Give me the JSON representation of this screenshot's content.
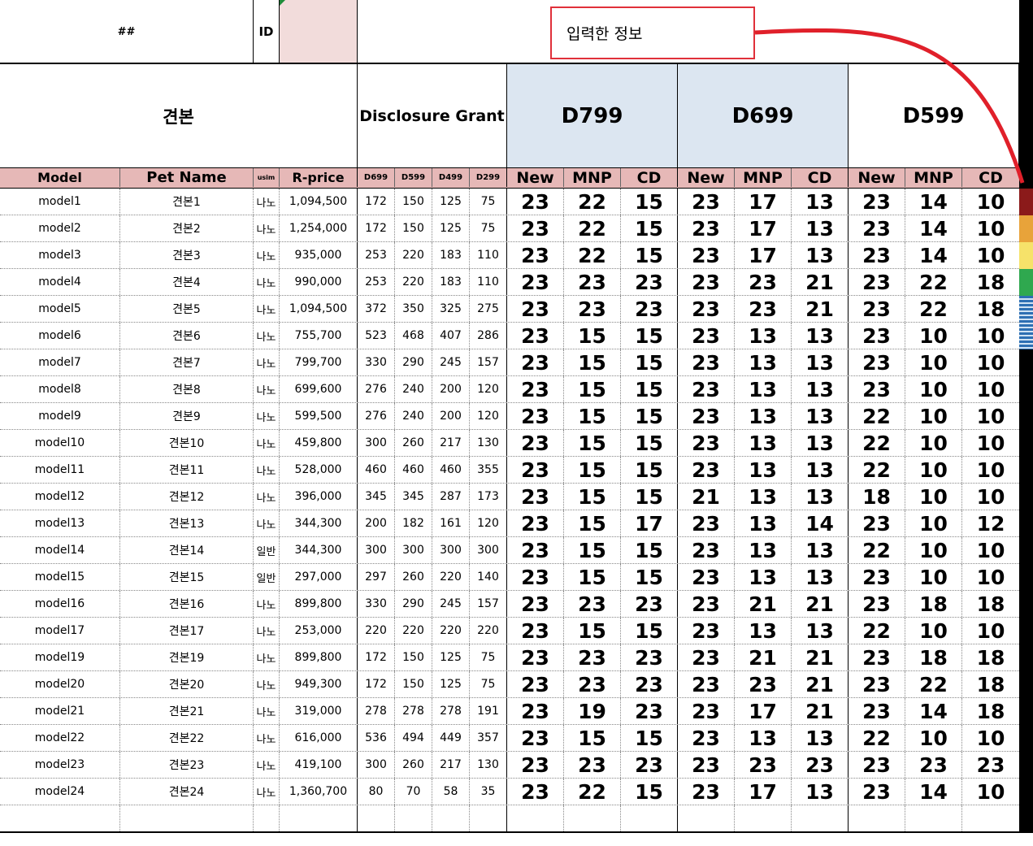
{
  "top": {
    "hash": "##",
    "id_label": "ID",
    "id_value": "",
    "callout": "입력한 정보"
  },
  "header": {
    "sample": "견본",
    "disclosure": "Disclosure Grant",
    "plans": [
      "D799",
      "D699",
      "D599"
    ]
  },
  "columns": {
    "model": "Model",
    "pet_name": "Pet Name",
    "usim": "usim",
    "rprice": "R-price",
    "grants": [
      "D699",
      "D599",
      "D499",
      "D299"
    ],
    "sub": [
      "New",
      "MNP",
      "CD"
    ]
  },
  "rows": [
    {
      "model": "model1",
      "pet": "견본1",
      "usim": "나노",
      "price": "1,094,500",
      "g": [
        "172",
        "150",
        "125",
        "75"
      ],
      "v": [
        "23",
        "22",
        "15",
        "23",
        "17",
        "13",
        "23",
        "14",
        "10"
      ]
    },
    {
      "model": "model2",
      "pet": "견본2",
      "usim": "나노",
      "price": "1,254,000",
      "g": [
        "172",
        "150",
        "125",
        "75"
      ],
      "v": [
        "23",
        "22",
        "15",
        "23",
        "17",
        "13",
        "23",
        "14",
        "10"
      ]
    },
    {
      "model": "model3",
      "pet": "견본3",
      "usim": "나노",
      "price": "935,000",
      "g": [
        "253",
        "220",
        "183",
        "110"
      ],
      "v": [
        "23",
        "22",
        "15",
        "23",
        "17",
        "13",
        "23",
        "14",
        "10"
      ]
    },
    {
      "model": "model4",
      "pet": "견본4",
      "usim": "나노",
      "price": "990,000",
      "g": [
        "253",
        "220",
        "183",
        "110"
      ],
      "v": [
        "23",
        "23",
        "23",
        "23",
        "23",
        "21",
        "23",
        "22",
        "18"
      ]
    },
    {
      "model": "model5",
      "pet": "견본5",
      "usim": "나노",
      "price": "1,094,500",
      "g": [
        "372",
        "350",
        "325",
        "275"
      ],
      "v": [
        "23",
        "23",
        "23",
        "23",
        "23",
        "21",
        "23",
        "22",
        "18"
      ]
    },
    {
      "model": "model6",
      "pet": "견본6",
      "usim": "나노",
      "price": "755,700",
      "g": [
        "523",
        "468",
        "407",
        "286"
      ],
      "v": [
        "23",
        "15",
        "15",
        "23",
        "13",
        "13",
        "23",
        "10",
        "10"
      ]
    },
    {
      "model": "model7",
      "pet": "견본7",
      "usim": "나노",
      "price": "799,700",
      "g": [
        "330",
        "290",
        "245",
        "157"
      ],
      "v": [
        "23",
        "15",
        "15",
        "23",
        "13",
        "13",
        "23",
        "10",
        "10"
      ]
    },
    {
      "model": "model8",
      "pet": "견본8",
      "usim": "나노",
      "price": "699,600",
      "g": [
        "276",
        "240",
        "200",
        "120"
      ],
      "v": [
        "23",
        "15",
        "15",
        "23",
        "13",
        "13",
        "23",
        "10",
        "10"
      ]
    },
    {
      "model": "model9",
      "pet": "견본9",
      "usim": "나노",
      "price": "599,500",
      "g": [
        "276",
        "240",
        "200",
        "120"
      ],
      "v": [
        "23",
        "15",
        "15",
        "23",
        "13",
        "13",
        "22",
        "10",
        "10"
      ]
    },
    {
      "model": "model10",
      "pet": "견본10",
      "usim": "나노",
      "price": "459,800",
      "g": [
        "300",
        "260",
        "217",
        "130"
      ],
      "v": [
        "23",
        "15",
        "15",
        "23",
        "13",
        "13",
        "22",
        "10",
        "10"
      ]
    },
    {
      "model": "model11",
      "pet": "견본11",
      "usim": "나노",
      "price": "528,000",
      "g": [
        "460",
        "460",
        "460",
        "355"
      ],
      "v": [
        "23",
        "15",
        "15",
        "23",
        "13",
        "13",
        "22",
        "10",
        "10"
      ]
    },
    {
      "model": "model12",
      "pet": "견본12",
      "usim": "나노",
      "price": "396,000",
      "g": [
        "345",
        "345",
        "287",
        "173"
      ],
      "v": [
        "23",
        "15",
        "15",
        "21",
        "13",
        "13",
        "18",
        "10",
        "10"
      ]
    },
    {
      "model": "model13",
      "pet": "견본13",
      "usim": "나노",
      "price": "344,300",
      "g": [
        "200",
        "182",
        "161",
        "120"
      ],
      "v": [
        "23",
        "15",
        "17",
        "23",
        "13",
        "14",
        "23",
        "10",
        "12"
      ]
    },
    {
      "model": "model14",
      "pet": "견본14",
      "usim": "일반",
      "price": "344,300",
      "g": [
        "300",
        "300",
        "300",
        "300"
      ],
      "v": [
        "23",
        "15",
        "15",
        "23",
        "13",
        "13",
        "22",
        "10",
        "10"
      ]
    },
    {
      "model": "model15",
      "pet": "견본15",
      "usim": "일반",
      "price": "297,000",
      "g": [
        "297",
        "260",
        "220",
        "140"
      ],
      "v": [
        "23",
        "15",
        "15",
        "23",
        "13",
        "13",
        "23",
        "10",
        "10"
      ]
    },
    {
      "model": "model16",
      "pet": "견본16",
      "usim": "나노",
      "price": "899,800",
      "g": [
        "330",
        "290",
        "245",
        "157"
      ],
      "v": [
        "23",
        "23",
        "23",
        "23",
        "21",
        "21",
        "23",
        "18",
        "18"
      ]
    },
    {
      "model": "model17",
      "pet": "견본17",
      "usim": "나노",
      "price": "253,000",
      "g": [
        "220",
        "220",
        "220",
        "220"
      ],
      "v": [
        "23",
        "15",
        "15",
        "23",
        "13",
        "13",
        "22",
        "10",
        "10"
      ]
    },
    {
      "model": "model19",
      "pet": "견본19",
      "usim": "나노",
      "price": "899,800",
      "g": [
        "172",
        "150",
        "125",
        "75"
      ],
      "v": [
        "23",
        "23",
        "23",
        "23",
        "21",
        "21",
        "23",
        "18",
        "18"
      ]
    },
    {
      "model": "model20",
      "pet": "견본20",
      "usim": "나노",
      "price": "949,300",
      "g": [
        "172",
        "150",
        "125",
        "75"
      ],
      "v": [
        "23",
        "23",
        "23",
        "23",
        "23",
        "21",
        "23",
        "22",
        "18"
      ]
    },
    {
      "model": "model21",
      "pet": "견본21",
      "usim": "나노",
      "price": "319,000",
      "g": [
        "278",
        "278",
        "278",
        "191"
      ],
      "v": [
        "23",
        "19",
        "23",
        "23",
        "17",
        "21",
        "23",
        "14",
        "18"
      ]
    },
    {
      "model": "model22",
      "pet": "견본22",
      "usim": "나노",
      "price": "616,000",
      "g": [
        "536",
        "494",
        "449",
        "357"
      ],
      "v": [
        "23",
        "15",
        "15",
        "23",
        "13",
        "13",
        "22",
        "10",
        "10"
      ]
    },
    {
      "model": "model23",
      "pet": "견본23",
      "usim": "나노",
      "price": "419,100",
      "g": [
        "300",
        "260",
        "217",
        "130"
      ],
      "v": [
        "23",
        "23",
        "23",
        "23",
        "23",
        "23",
        "23",
        "23",
        "23"
      ]
    },
    {
      "model": "model24",
      "pet": "견본24",
      "usim": "나노",
      "price": "1,360,700",
      "g": [
        "80",
        "70",
        "58",
        "35"
      ],
      "v": [
        "23",
        "22",
        "15",
        "23",
        "17",
        "13",
        "23",
        "14",
        "10"
      ]
    }
  ],
  "colors": {
    "header_pink": "#e6b8b7",
    "plan_blue": "#dce6f1",
    "id_pink": "#f2dcdb",
    "callout_red": "#e0303a"
  }
}
